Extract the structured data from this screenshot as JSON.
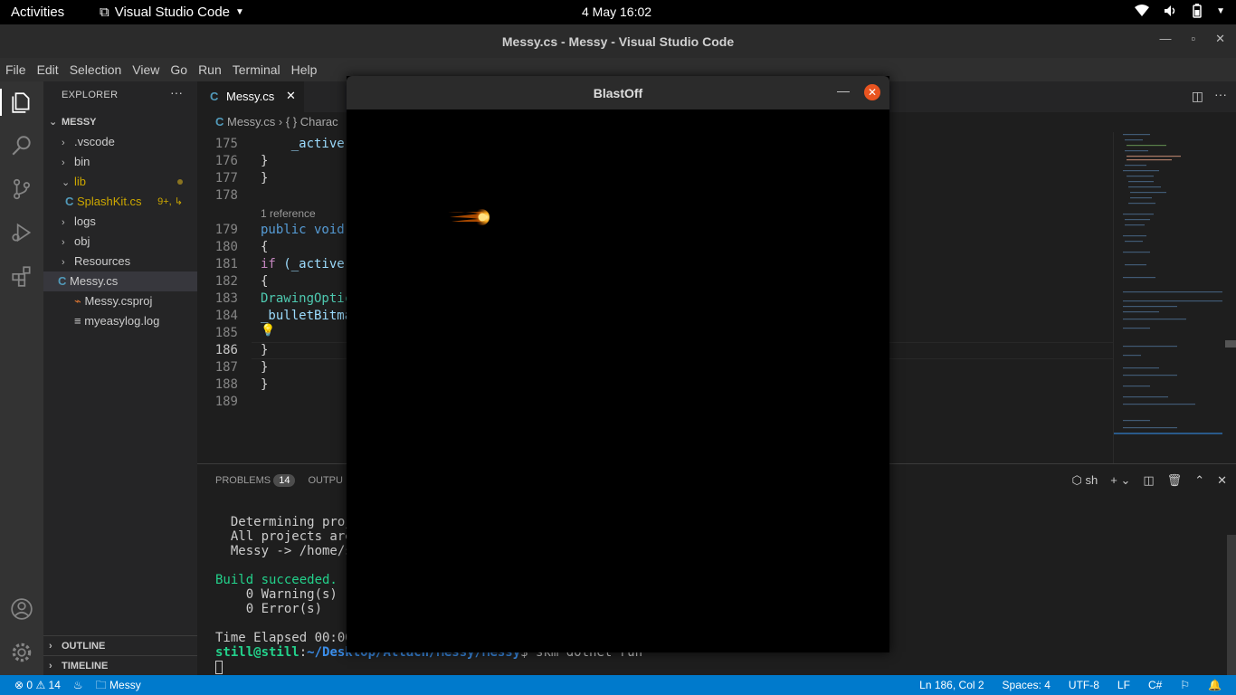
{
  "topbar": {
    "activities": "Activities",
    "app_name": "Visual Studio Code",
    "clock": "4 May  16:02"
  },
  "window": {
    "title": "Messy.cs - Messy - Visual Studio Code"
  },
  "menu": [
    "File",
    "Edit",
    "Selection",
    "View",
    "Go",
    "Run",
    "Terminal",
    "Help"
  ],
  "sidebar": {
    "header": "EXPLORER",
    "project": "MESSY",
    "items": [
      {
        "label": ".vscode"
      },
      {
        "label": "bin"
      },
      {
        "label": "lib"
      },
      {
        "label": "SplashKit.cs",
        "badge": "9+, ↳"
      },
      {
        "label": "logs"
      },
      {
        "label": "obj"
      },
      {
        "label": "Resources"
      },
      {
        "label": "Messy.cs"
      },
      {
        "label": "Messy.csproj"
      },
      {
        "label": "myeasylog.log"
      }
    ],
    "outline": "OUTLINE",
    "timeline": "TIMELINE"
  },
  "editor": {
    "tab_label": "Messy.cs",
    "breadcrumb_file": "Messy.cs",
    "breadcrumb_symbol": "{ } Charac",
    "codelens": "1 reference",
    "lines": [
      {
        "n": "175",
        "text": "    _active"
      },
      {
        "n": "176",
        "text": "}"
      },
      {
        "n": "177",
        "text": "}"
      },
      {
        "n": "178",
        "text": ""
      },
      {
        "n": "179",
        "kw": "public void",
        "text": ""
      },
      {
        "n": "180",
        "text": "{"
      },
      {
        "n": "181",
        "kw": "if",
        "text": " (_active"
      },
      {
        "n": "182",
        "text": "{"
      },
      {
        "n": "183",
        "ty": "DrawingOptic",
        "text": ""
      },
      {
        "n": "184",
        "text": "_bulletBitma"
      },
      {
        "n": "185",
        "text": ""
      },
      {
        "n": "186",
        "text": "}"
      },
      {
        "n": "187",
        "text": "}"
      },
      {
        "n": "188",
        "text": "}"
      },
      {
        "n": "189",
        "text": ""
      }
    ]
  },
  "panel": {
    "problems_label": "PROBLEMS",
    "problems_count": "14",
    "output_label": "OUTPU",
    "shell": "sh",
    "terminal": {
      "l1": "  Determining proj",
      "l2": "  All projects are",
      "l3": "  Messy -> /home/s",
      "l4": "Build succeeded.",
      "l5": "    0 Warning(s)",
      "l6": "    0 Error(s)",
      "l7": "Time Elapsed 00:00",
      "user": "still@still",
      "path": "~/Desktop/Attach/Messy/Messy",
      "cmd": "$ skm dotnet run"
    }
  },
  "statusbar": {
    "errors": "0",
    "warnings": "14",
    "project": "Messy",
    "position": "Ln 186, Col 2",
    "spaces": "Spaces: 4",
    "encoding": "UTF-8",
    "eol": "LF",
    "language": "C#"
  },
  "blastoff": {
    "title": "BlastOff"
  }
}
